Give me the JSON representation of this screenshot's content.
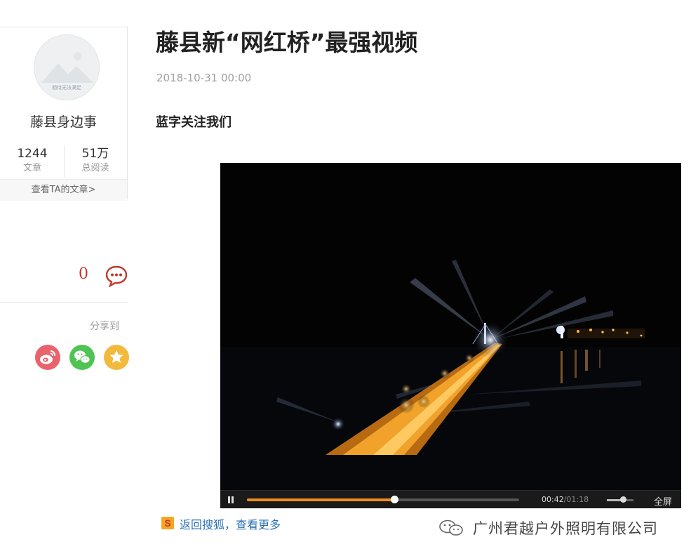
{
  "author": {
    "avatar_caption": "期待无法满足",
    "name": "藤县身边事",
    "stats": [
      {
        "value": "1244",
        "label": "文章"
      },
      {
        "value": "51万",
        "label": "总阅读"
      }
    ],
    "view_articles": "查看TA的文章>"
  },
  "comments": {
    "count": "0"
  },
  "share": {
    "label": "分享到",
    "targets": [
      "weibo-icon",
      "wechat-icon",
      "favorite-icon"
    ]
  },
  "article": {
    "title": "藤县新“网红桥”最强视频",
    "date": "2018-10-31 00:00",
    "lead": "蓝字关注我们"
  },
  "video": {
    "current_time": "00:42",
    "duration": "/01:18",
    "progress": 0.54,
    "volume": 0.6,
    "fullscreen_label": "全屏"
  },
  "footer": {
    "sohu_link": "返回搜狐，查看更多",
    "watermark": "广州君越户外照明有限公司"
  },
  "colors": {
    "comment_count": "#c0392b",
    "progress": "#f08c1e",
    "weibo": "#e9636d",
    "wechat": "#4fc453",
    "favorite": "#f3b93c",
    "link": "#2a6fb4"
  }
}
